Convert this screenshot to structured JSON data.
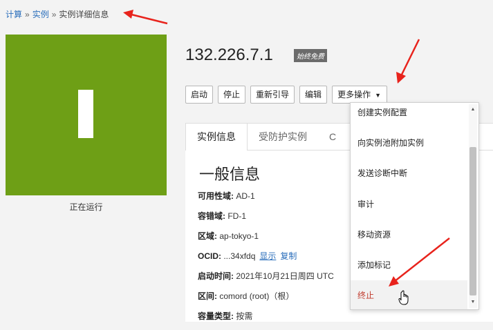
{
  "breadcrumb": {
    "items": [
      "计算",
      "实例",
      "实例详细信息"
    ],
    "separator": "»"
  },
  "instance": {
    "title": "132.226.7.1",
    "badge": "始终免费",
    "status": "正在运行",
    "tile_color": "#6e9f16"
  },
  "actions": {
    "start": "启动",
    "stop": "停止",
    "reboot": "重新引导",
    "edit": "编辑",
    "more": "更多操作"
  },
  "tabs": [
    "实例信息",
    "受防护实例",
    "C"
  ],
  "info": {
    "section_title": "一般信息",
    "rows": [
      {
        "label": "可用性域:",
        "value": "AD-1"
      },
      {
        "label": "容错域:",
        "value": "FD-1"
      },
      {
        "label": "区域:",
        "value": "ap-tokyo-1"
      },
      {
        "label": "OCID:",
        "value": "...34xfdq",
        "link1": "显示",
        "link2": "复制"
      },
      {
        "label": "启动时间:",
        "value": "2021年10月21日周四 UTC"
      },
      {
        "label": "区间:",
        "value": "comord (root)（根）"
      },
      {
        "label": "容量类型:",
        "value": "按需"
      }
    ]
  },
  "dropdown": {
    "items": [
      "创建实例配置",
      "向实例池附加实例",
      "发送诊断中断",
      "审计",
      "移动资源",
      "添加标记",
      "终止"
    ],
    "danger_color": "#c0392b"
  },
  "annotation_color": "#e8231c"
}
